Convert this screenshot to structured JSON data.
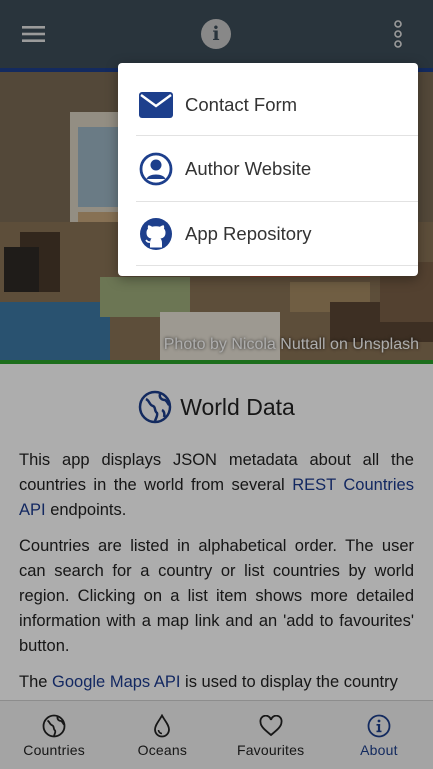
{
  "toolbar": {
    "menu_icon": "hamburger-menu-icon",
    "info_icon": "info-icon",
    "info_glyph": "i",
    "more_icon": "more-vertical-icon",
    "color": "#3d4d59"
  },
  "hero": {
    "credit": "Photo by Nicola Nuttall on Unsplash"
  },
  "content": {
    "title": "World Data",
    "title_icon": "globe-icon",
    "paragraph1": {
      "before": "This app displays JSON metadata about all the countries in the world from several ",
      "link": "REST Countries API",
      "after": " endpoints."
    },
    "paragraph2": "Countries are listed in alphabetical order. The user can search for a country or list countries by world region. Clicking on a list item shows more detailed information with a map link and an 'add to favourites' button.",
    "paragraph3": {
      "before": "The ",
      "link": "Google Maps API",
      "after": " is used to display the country"
    }
  },
  "popup_menu": {
    "items": [
      {
        "label": "Contact Form",
        "icon": "mail-icon"
      },
      {
        "label": "Author Website",
        "icon": "user-circle-icon"
      },
      {
        "label": "App Repository",
        "icon": "github-icon"
      }
    ]
  },
  "bottom_nav": {
    "items": [
      {
        "label": "Countries",
        "icon": "globe-icon",
        "active": false
      },
      {
        "label": "Oceans",
        "icon": "water-drop-icon",
        "active": false
      },
      {
        "label": "Favourites",
        "icon": "heart-icon",
        "active": false
      },
      {
        "label": "About",
        "icon": "info-circle-icon",
        "active": true
      }
    ]
  },
  "colors": {
    "accent": "#1d3f8c",
    "hero_bottom_line": "#2aa22a",
    "link": "#1c3b8f"
  }
}
